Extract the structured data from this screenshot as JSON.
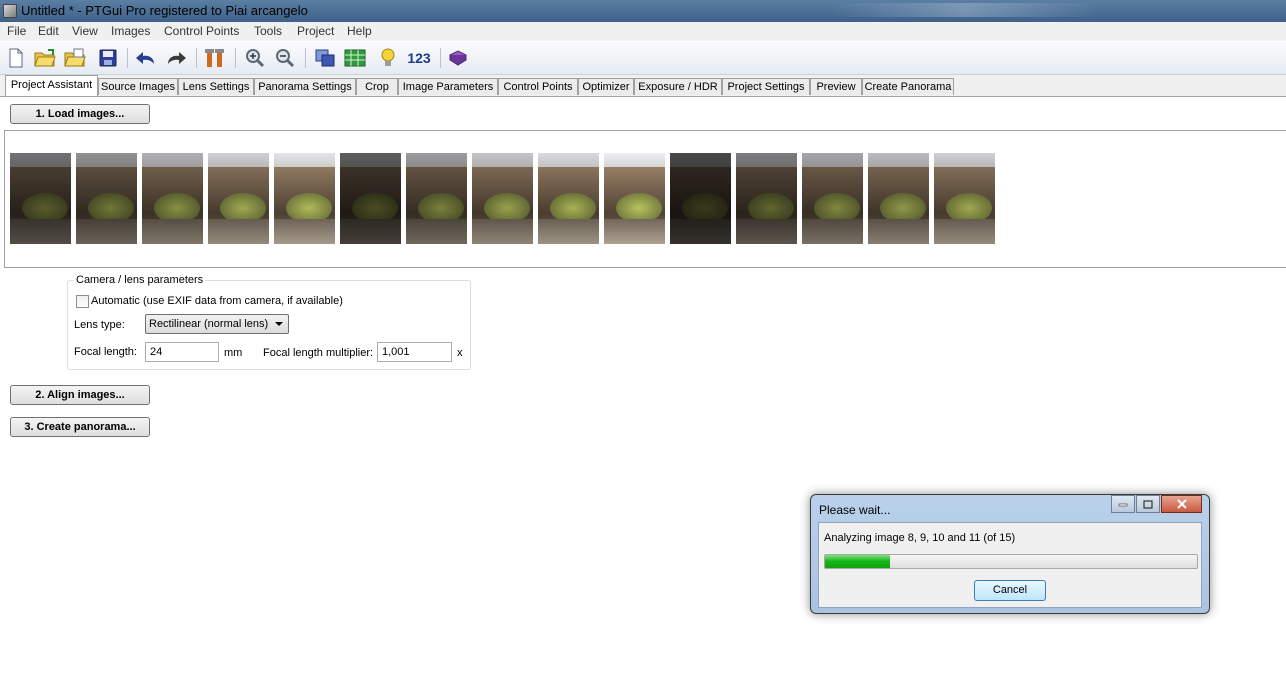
{
  "window": {
    "title": "Untitled * - PTGui Pro registered to Piai arcangelo"
  },
  "menu": [
    "File",
    "Edit",
    "View",
    "Images",
    "Control Points",
    "Tools",
    "Project",
    "Help"
  ],
  "toolbar": {
    "icons": [
      "new-file-icon",
      "open-folder-icon",
      "open-recent-icon",
      "save-icon",
      "undo-icon",
      "redo-icon",
      "tools-icon",
      "zoom-in-icon",
      "zoom-out-icon",
      "panorama-editor-icon",
      "table-icon",
      "lightbulb-icon",
      "numbering-icon",
      "book-icon"
    ],
    "numbering_label": "123"
  },
  "tabs": [
    "Project Assistant",
    "Source Images",
    "Lens Settings",
    "Panorama Settings",
    "Crop",
    "Image Parameters",
    "Control Points",
    "Optimizer",
    "Exposure / HDR",
    "Project Settings",
    "Preview",
    "Create Panorama"
  ],
  "active_tab": "Project Assistant",
  "steps": {
    "load": "1. Load images...",
    "align": "2. Align images...",
    "create": "3. Create panorama..."
  },
  "thumbnails": {
    "count": 15
  },
  "camera": {
    "group_title": "Camera / lens parameters",
    "automatic_label": "Automatic (use EXIF data from camera, if available)",
    "automatic_checked": false,
    "lens_type_label": "Lens type:",
    "lens_type_value": "Rectilinear (normal lens)",
    "focal_length_label": "Focal length:",
    "focal_length_value": "24",
    "focal_length_unit": "mm",
    "multiplier_label": "Focal length multiplier:",
    "multiplier_value": "1,001",
    "multiplier_unit": "x"
  },
  "dialog": {
    "title": "Please wait...",
    "message": "Analyzing image 8, 9, 10 and 11 (of 15)",
    "progress_fraction": 0.175,
    "cancel_label": "Cancel"
  },
  "colors": {
    "progress_green": "#16b516",
    "titlebar": "#4a6d94"
  }
}
